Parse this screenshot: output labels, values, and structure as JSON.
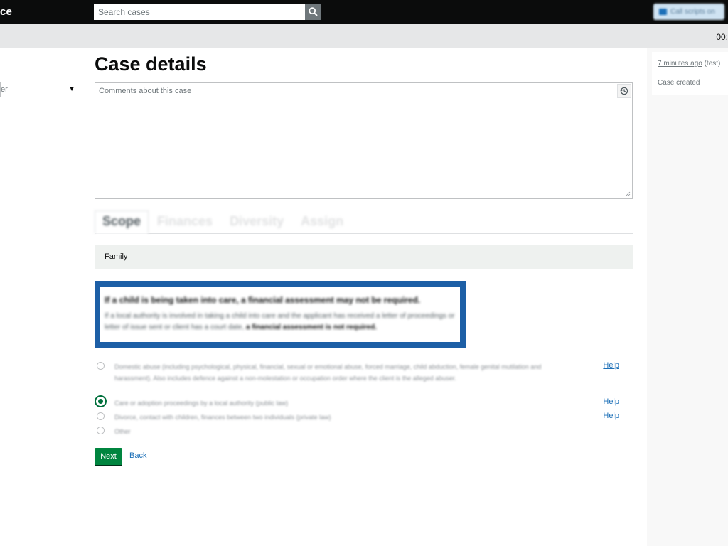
{
  "header": {
    "brand": "ce",
    "search_placeholder": "Search cases",
    "call_scripts_label": "Call scripts on",
    "timer": "00:"
  },
  "left": {
    "select_value": "er"
  },
  "main": {
    "title": "Case details",
    "comments_placeholder": "Comments about this case",
    "tabs": [
      {
        "label": "Scope",
        "active": true
      },
      {
        "label": "Finances",
        "active": false
      },
      {
        "label": "Diversity",
        "active": false
      },
      {
        "label": "Assign",
        "active": false
      }
    ],
    "category": "Family",
    "notice": {
      "title": "If a child is being taken into care, a financial assessment may not be required.",
      "body_text": "If a local authority is involved in taking a child into care and the applicant has received a letter of proceedings or letter of issue sent or client has a court date,",
      "body_bold": "a financial assessment is not required."
    },
    "options": [
      {
        "label": "Domestic abuse (including psychological, physical, financial, sexual or emotional abuse, forced marriage, child abduction, female genital mutilation and harassment). Also includes defence against a non-molestation or occupation order where the client is the alleged abuser.",
        "help": "Help",
        "selected": false
      },
      {
        "label": "Care or adoption proceedings by a local authority (public law)",
        "help": "Help",
        "selected": true
      },
      {
        "label": "Divorce, contact with children, finances between two individuals (private law)",
        "help": "Help",
        "selected": false
      },
      {
        "label": "Other",
        "help": "",
        "selected": false
      }
    ],
    "next_label": "Next",
    "back_label": "Back"
  },
  "sidebar": {
    "time_link": "7 minutes ago",
    "time_user": " (test)",
    "event": "Case created"
  },
  "colors": {
    "header_bg": "#0b0c0c",
    "notice_border": "#1d5fa6",
    "primary_button": "#00853f",
    "link": "#1d70b8"
  }
}
